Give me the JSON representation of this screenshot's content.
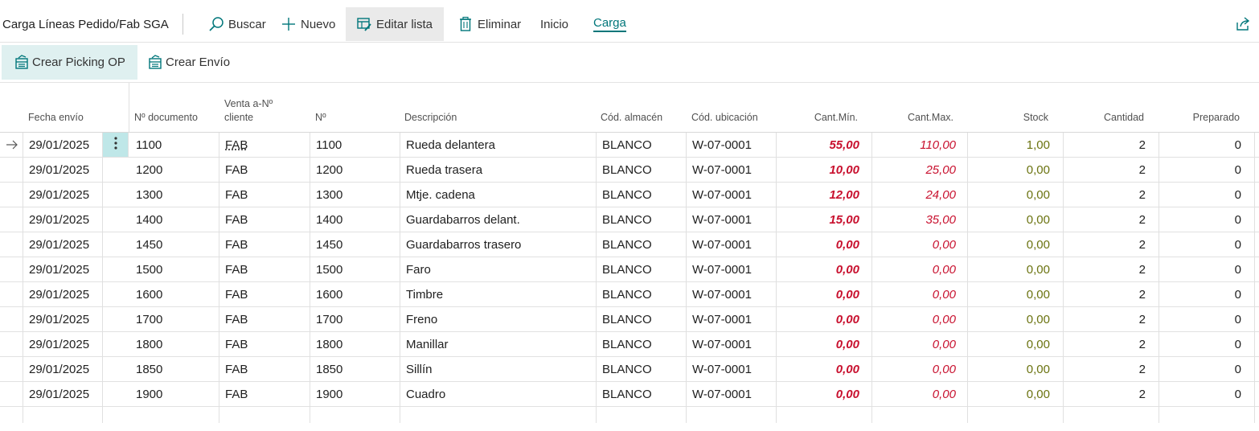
{
  "header": {
    "title": "Carga Líneas Pedido/Fab SGA",
    "actions": [
      {
        "label": "Buscar",
        "icon": "search-icon"
      },
      {
        "label": "Nuevo",
        "icon": "plus-icon"
      },
      {
        "label": "Editar lista",
        "icon": "edit-list-icon"
      },
      {
        "label": "Eliminar",
        "icon": "trash-icon"
      },
      {
        "label": "Inicio"
      },
      {
        "label": "Carga"
      }
    ],
    "share_icon": "share-icon"
  },
  "subactions": [
    {
      "label": "Crear Picking OP",
      "icon": "create-doc-icon"
    },
    {
      "label": "Crear Envío",
      "icon": "create-doc-icon"
    }
  ],
  "columns": {
    "fecha_envio": "Fecha envío",
    "num_documento": "Nº documento",
    "venta_cliente": "Venta a-Nº cliente",
    "num": "Nº",
    "descripcion": "Descripción",
    "cod_almacen": "Cód. almacén",
    "cod_ubicacion": "Cód. ubicación",
    "cant_min": "Cant.Mín.",
    "cant_max": "Cant.Max.",
    "stock": "Stock",
    "cantidad": "Cantidad",
    "preparado": "Preparado"
  },
  "rows": [
    {
      "fecha": "29/01/2025",
      "doc": "1100",
      "cliente": "FAB",
      "num": "1100",
      "desc": "Rueda delantera",
      "almacen": "BLANCO",
      "ubicacion": "W-07-0001",
      "min": "55,00",
      "max": "110,00",
      "stock": "1,00",
      "cantidad": "2",
      "preparado": "0"
    },
    {
      "fecha": "29/01/2025",
      "doc": "1200",
      "cliente": "FAB",
      "num": "1200",
      "desc": "Rueda trasera",
      "almacen": "BLANCO",
      "ubicacion": "W-07-0001",
      "min": "10,00",
      "max": "25,00",
      "stock": "0,00",
      "cantidad": "2",
      "preparado": "0"
    },
    {
      "fecha": "29/01/2025",
      "doc": "1300",
      "cliente": "FAB",
      "num": "1300",
      "desc": "Mtje. cadena",
      "almacen": "BLANCO",
      "ubicacion": "W-07-0001",
      "min": "12,00",
      "max": "24,00",
      "stock": "0,00",
      "cantidad": "2",
      "preparado": "0"
    },
    {
      "fecha": "29/01/2025",
      "doc": "1400",
      "cliente": "FAB",
      "num": "1400",
      "desc": "Guardabarros delant.",
      "almacen": "BLANCO",
      "ubicacion": "W-07-0001",
      "min": "15,00",
      "max": "35,00",
      "stock": "0,00",
      "cantidad": "2",
      "preparado": "0"
    },
    {
      "fecha": "29/01/2025",
      "doc": "1450",
      "cliente": "FAB",
      "num": "1450",
      "desc": "Guardabarros trasero",
      "almacen": "BLANCO",
      "ubicacion": "W-07-0001",
      "min": "0,00",
      "max": "0,00",
      "stock": "0,00",
      "cantidad": "2",
      "preparado": "0"
    },
    {
      "fecha": "29/01/2025",
      "doc": "1500",
      "cliente": "FAB",
      "num": "1500",
      "desc": "Faro",
      "almacen": "BLANCO",
      "ubicacion": "W-07-0001",
      "min": "0,00",
      "max": "0,00",
      "stock": "0,00",
      "cantidad": "2",
      "preparado": "0"
    },
    {
      "fecha": "29/01/2025",
      "doc": "1600",
      "cliente": "FAB",
      "num": "1600",
      "desc": "Timbre",
      "almacen": "BLANCO",
      "ubicacion": "W-07-0001",
      "min": "0,00",
      "max": "0,00",
      "stock": "0,00",
      "cantidad": "2",
      "preparado": "0"
    },
    {
      "fecha": "29/01/2025",
      "doc": "1700",
      "cliente": "FAB",
      "num": "1700",
      "desc": "Freno",
      "almacen": "BLANCO",
      "ubicacion": "W-07-0001",
      "min": "0,00",
      "max": "0,00",
      "stock": "0,00",
      "cantidad": "2",
      "preparado": "0"
    },
    {
      "fecha": "29/01/2025",
      "doc": "1800",
      "cliente": "FAB",
      "num": "1800",
      "desc": "Manillar",
      "almacen": "BLANCO",
      "ubicacion": "W-07-0001",
      "min": "0,00",
      "max": "0,00",
      "stock": "0,00",
      "cantidad": "2",
      "preparado": "0"
    },
    {
      "fecha": "29/01/2025",
      "doc": "1850",
      "cliente": "FAB",
      "num": "1850",
      "desc": "Sillín",
      "almacen": "BLANCO",
      "ubicacion": "W-07-0001",
      "min": "0,00",
      "max": "0,00",
      "stock": "0,00",
      "cantidad": "2",
      "preparado": "0"
    },
    {
      "fecha": "29/01/2025",
      "doc": "1900",
      "cliente": "FAB",
      "num": "1900",
      "desc": "Cuadro",
      "almacen": "BLANCO",
      "ubicacion": "W-07-0001",
      "min": "0,00",
      "max": "0,00",
      "stock": "0,00",
      "cantidad": "2",
      "preparado": "0"
    }
  ],
  "colors": {
    "accent": "#00767a",
    "minmax_red": "#c8102e",
    "stock_olive": "#6b7310",
    "selected_bg": "#dff0f0"
  }
}
